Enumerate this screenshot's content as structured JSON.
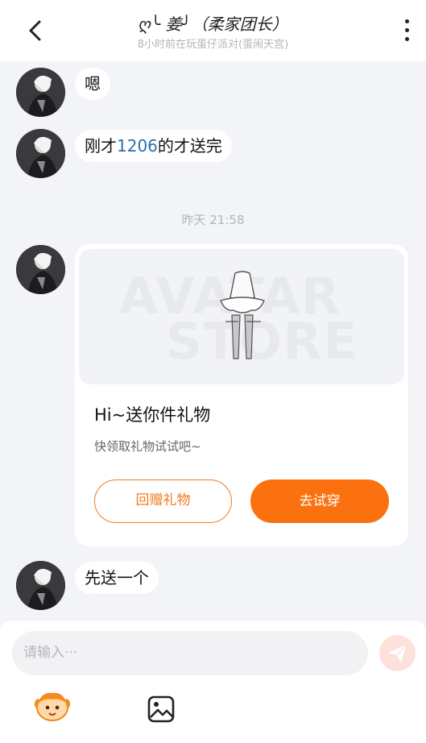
{
  "header": {
    "title": "ღ╰ 姜╯（柔家团长）",
    "subtitle": "8小时前在玩蛋仔派对(蛋闹天宫)"
  },
  "messages": [
    {
      "text": "嗯"
    },
    {
      "text_before": "刚才",
      "highlight": "1206",
      "text_after": "的才送完"
    }
  ],
  "timestamp": "昨天 21:58",
  "gift_card": {
    "title": "Hi~送你件礼物",
    "subtitle": "快领取礼物试试吧~",
    "return_label": "回赠礼物",
    "try_label": "去试穿",
    "watermark_line1": "AVATAR",
    "watermark_line2": "STORE"
  },
  "last_message": "先送一个",
  "composer": {
    "placeholder": "请输入···"
  },
  "colors": {
    "accent": "#fb7110",
    "link": "#2c6fa8",
    "background": "#f3f4f8"
  },
  "icons": {
    "back": "chevron-left-icon",
    "more": "more-vertical-icon",
    "send": "paper-plane-icon",
    "emoji": "eggy-emoji-icon",
    "image": "image-icon"
  }
}
